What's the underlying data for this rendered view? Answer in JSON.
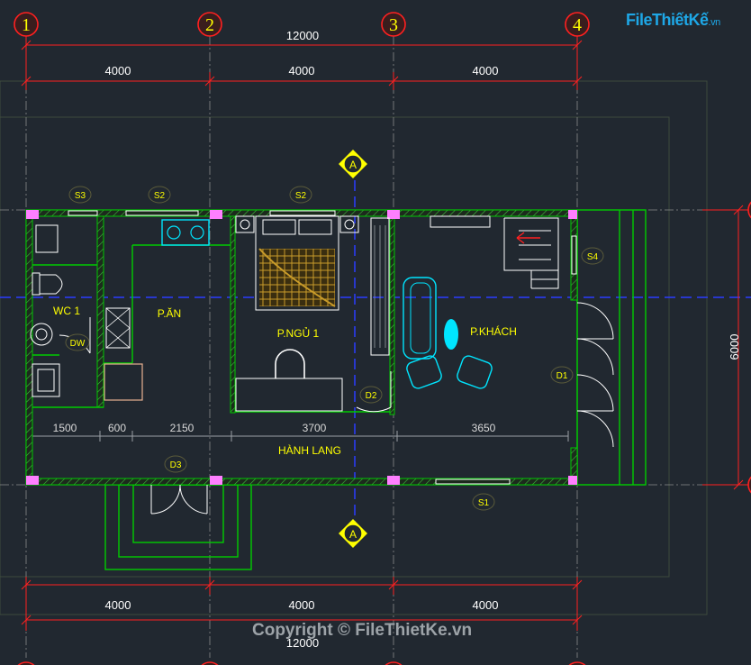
{
  "grid_labels": [
    "1",
    "2",
    "3",
    "4"
  ],
  "section_label": "A",
  "overall_width": "12000",
  "bay_dims": [
    "4000",
    "4000",
    "4000"
  ],
  "side_dim": "6000",
  "inner_dims": [
    "1500",
    "600",
    "2150",
    "3700",
    "3650"
  ],
  "rooms": {
    "wc": "WC 1",
    "dining": "P.ĂN",
    "bedroom": "P.NGỦ 1",
    "living": "P.KHÁCH",
    "hall": "HÀNH LANG"
  },
  "tags": {
    "s3": "S3",
    "s2a": "S2",
    "s2b": "S2",
    "s4": "S4",
    "s1": "S1",
    "d1": "D1",
    "d2": "D2",
    "d3": "D3",
    "dw": "DW"
  },
  "watermark": {
    "main": "FileThiếtKế",
    "suffix": ".vn"
  },
  "copyright": "Copyright © FileThietKe.vn",
  "colors": {
    "background": "#212830",
    "wall": "#00c800",
    "dimension": "#ff2020",
    "label": "#ffff00",
    "furniture": "#00e5ff",
    "axis": "#2a3cff"
  }
}
